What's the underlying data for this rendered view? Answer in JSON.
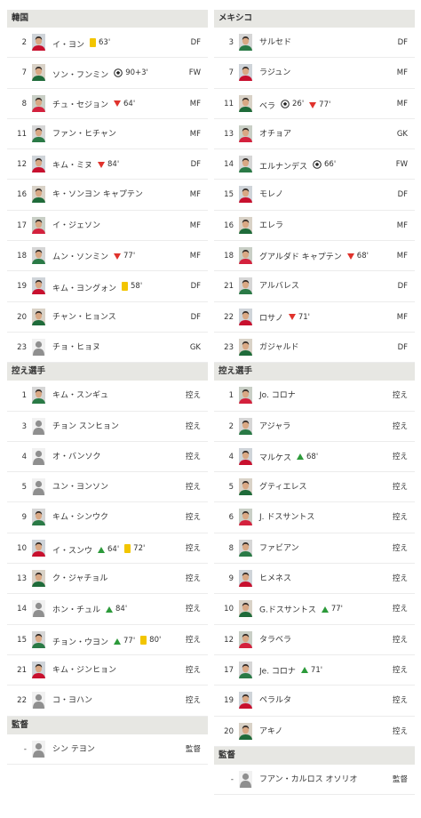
{
  "colors": {
    "section_bg": "#e7e7e3",
    "yellow_card": "#f2c500",
    "sub_out": "#e0322c",
    "sub_in": "#2c9a3a"
  },
  "columns": [
    {
      "sections": [
        {
          "title": "韓国",
          "coach": false,
          "rows": [
            {
              "num": "2",
              "name": "イ・ヨン",
              "pos": "DF",
              "photo": "player-photo",
              "events": [
                {
                  "type": "yellow-card-icon",
                  "text": "63'"
                }
              ]
            },
            {
              "num": "7",
              "name": "ソン・フンミン",
              "pos": "FW",
              "photo": "player-photo",
              "events": [
                {
                  "type": "goal-ball-icon",
                  "text": "90+3'"
                }
              ]
            },
            {
              "num": "8",
              "name": "チュ・セジョン",
              "pos": "MF",
              "photo": "player-photo",
              "events": [
                {
                  "type": "sub-out-icon",
                  "text": "64'"
                }
              ]
            },
            {
              "num": "11",
              "name": "ファン・ヒチャン",
              "pos": "MF",
              "photo": "player-photo",
              "events": []
            },
            {
              "num": "12",
              "name": "キム・ミヌ",
              "pos": "DF",
              "photo": "player-photo",
              "events": [
                {
                  "type": "sub-out-icon",
                  "text": "84'"
                }
              ]
            },
            {
              "num": "16",
              "name": "キ・ソンヨン キャプテン",
              "pos": "MF",
              "photo": "player-photo",
              "events": []
            },
            {
              "num": "17",
              "name": "イ・ジェソン",
              "pos": "MF",
              "photo": "player-photo",
              "events": []
            },
            {
              "num": "18",
              "name": "ムン・ソンミン",
              "pos": "MF",
              "photo": "player-photo",
              "events": [
                {
                  "type": "sub-out-icon",
                  "text": "77'"
                }
              ]
            },
            {
              "num": "19",
              "name": "キム・ヨングォン",
              "pos": "DF",
              "photo": "player-photo",
              "events": [
                {
                  "type": "yellow-card-icon",
                  "text": "58'"
                }
              ]
            },
            {
              "num": "20",
              "name": "チャン・ヒョンス",
              "pos": "DF",
              "photo": "player-photo",
              "events": []
            },
            {
              "num": "23",
              "name": "チョ・ヒョヌ",
              "pos": "GK",
              "photo": "silhouette",
              "events": []
            }
          ]
        },
        {
          "title": "控え選手",
          "coach": false,
          "rows": [
            {
              "num": "1",
              "name": "キム・スンギュ",
              "pos": "控え",
              "photo": "player-photo",
              "events": []
            },
            {
              "num": "3",
              "name": "チョン スンヒョン",
              "pos": "控え",
              "photo": "silhouette",
              "events": []
            },
            {
              "num": "4",
              "name": "オ・バンソク",
              "pos": "控え",
              "photo": "silhouette",
              "events": []
            },
            {
              "num": "5",
              "name": "ユン・ヨンソン",
              "pos": "控え",
              "photo": "silhouette",
              "events": []
            },
            {
              "num": "9",
              "name": "キム・シンウク",
              "pos": "控え",
              "photo": "player-photo",
              "events": []
            },
            {
              "num": "10",
              "name": "イ・スンウ",
              "pos": "控え",
              "photo": "player-photo",
              "events": [
                {
                  "type": "sub-in-icon",
                  "text": "64'"
                },
                {
                  "type": "yellow-card-icon",
                  "text": "72'"
                }
              ]
            },
            {
              "num": "13",
              "name": "ク・ジャチョル",
              "pos": "控え",
              "photo": "player-photo",
              "events": []
            },
            {
              "num": "14",
              "name": "ホン・チュル",
              "pos": "控え",
              "photo": "silhouette",
              "events": [
                {
                  "type": "sub-in-icon",
                  "text": "84'"
                }
              ]
            },
            {
              "num": "15",
              "name": "チョン・ウヨン",
              "pos": "控え",
              "photo": "player-photo",
              "events": [
                {
                  "type": "sub-in-icon",
                  "text": "77'"
                },
                {
                  "type": "yellow-card-icon",
                  "text": "80'"
                }
              ]
            },
            {
              "num": "21",
              "name": "キム・ジンヒョン",
              "pos": "控え",
              "photo": "player-photo",
              "events": []
            },
            {
              "num": "22",
              "name": "コ・ヨハン",
              "pos": "控え",
              "photo": "silhouette",
              "events": []
            }
          ]
        },
        {
          "title": "監督",
          "coach": true,
          "rows": [
            {
              "num": "-",
              "name": "シン テヨン",
              "pos": "監督",
              "photo": "silhouette",
              "events": []
            }
          ]
        }
      ]
    },
    {
      "sections": [
        {
          "title": "メキシコ",
          "coach": false,
          "rows": [
            {
              "num": "3",
              "name": "サルセド",
              "pos": "DF",
              "photo": "player-photo",
              "events": []
            },
            {
              "num": "7",
              "name": "ラジュン",
              "pos": "MF",
              "photo": "player-photo",
              "events": []
            },
            {
              "num": "11",
              "name": "ベラ",
              "pos": "MF",
              "photo": "player-photo",
              "events": [
                {
                  "type": "goal-ball-icon",
                  "text": "26'"
                },
                {
                  "type": "sub-out-icon",
                  "text": "77'"
                }
              ]
            },
            {
              "num": "13",
              "name": "オチョア",
              "pos": "GK",
              "photo": "player-photo",
              "events": []
            },
            {
              "num": "14",
              "name": "エルナンデス",
              "pos": "FW",
              "photo": "player-photo",
              "events": [
                {
                  "type": "goal-ball-icon",
                  "text": "66'"
                }
              ]
            },
            {
              "num": "15",
              "name": "モレノ",
              "pos": "DF",
              "photo": "player-photo",
              "events": []
            },
            {
              "num": "16",
              "name": "エレラ",
              "pos": "MF",
              "photo": "player-photo",
              "events": []
            },
            {
              "num": "18",
              "name": "グアルダド キャプテン",
              "pos": "MF",
              "photo": "player-photo",
              "events": [
                {
                  "type": "sub-out-icon",
                  "text": "68'"
                }
              ]
            },
            {
              "num": "21",
              "name": "アルバレス",
              "pos": "DF",
              "photo": "player-photo",
              "events": []
            },
            {
              "num": "22",
              "name": "ロサノ",
              "pos": "MF",
              "photo": "player-photo",
              "events": [
                {
                  "type": "sub-out-icon",
                  "text": "71'"
                }
              ]
            },
            {
              "num": "23",
              "name": "ガジャルド",
              "pos": "DF",
              "photo": "player-photo",
              "events": []
            }
          ]
        },
        {
          "title": "控え選手",
          "coach": false,
          "rows": [
            {
              "num": "1",
              "name": "Jo. コロナ",
              "pos": "控え",
              "photo": "player-photo",
              "events": []
            },
            {
              "num": "2",
              "name": "アジャラ",
              "pos": "控え",
              "photo": "player-photo",
              "events": []
            },
            {
              "num": "4",
              "name": "マルケス",
              "pos": "控え",
              "photo": "player-photo",
              "events": [
                {
                  "type": "sub-in-icon",
                  "text": "68'"
                }
              ]
            },
            {
              "num": "5",
              "name": "グティエレス",
              "pos": "控え",
              "photo": "player-photo",
              "events": []
            },
            {
              "num": "6",
              "name": "J. ドスサントス",
              "pos": "控え",
              "photo": "player-photo",
              "events": []
            },
            {
              "num": "8",
              "name": "ファビアン",
              "pos": "控え",
              "photo": "player-photo",
              "events": []
            },
            {
              "num": "9",
              "name": "ヒメネス",
              "pos": "控え",
              "photo": "player-photo",
              "events": []
            },
            {
              "num": "10",
              "name": "G.ドスサントス",
              "pos": "控え",
              "photo": "player-photo",
              "events": [
                {
                  "type": "sub-in-icon",
                  "text": "77'"
                }
              ]
            },
            {
              "num": "12",
              "name": "タラベラ",
              "pos": "控え",
              "photo": "player-photo",
              "events": []
            },
            {
              "num": "17",
              "name": "Je. コロナ",
              "pos": "控え",
              "photo": "player-photo",
              "events": [
                {
                  "type": "sub-in-icon",
                  "text": "71'"
                }
              ]
            },
            {
              "num": "19",
              "name": "ペラルタ",
              "pos": "控え",
              "photo": "player-photo",
              "events": []
            },
            {
              "num": "20",
              "name": "アキノ",
              "pos": "控え",
              "photo": "player-photo",
              "events": []
            }
          ]
        },
        {
          "title": "監督",
          "coach": true,
          "rows": [
            {
              "num": "-",
              "name": "フアン・カルロス オソリオ",
              "pos": "監督",
              "photo": "silhouette",
              "events": []
            }
          ]
        }
      ]
    }
  ]
}
